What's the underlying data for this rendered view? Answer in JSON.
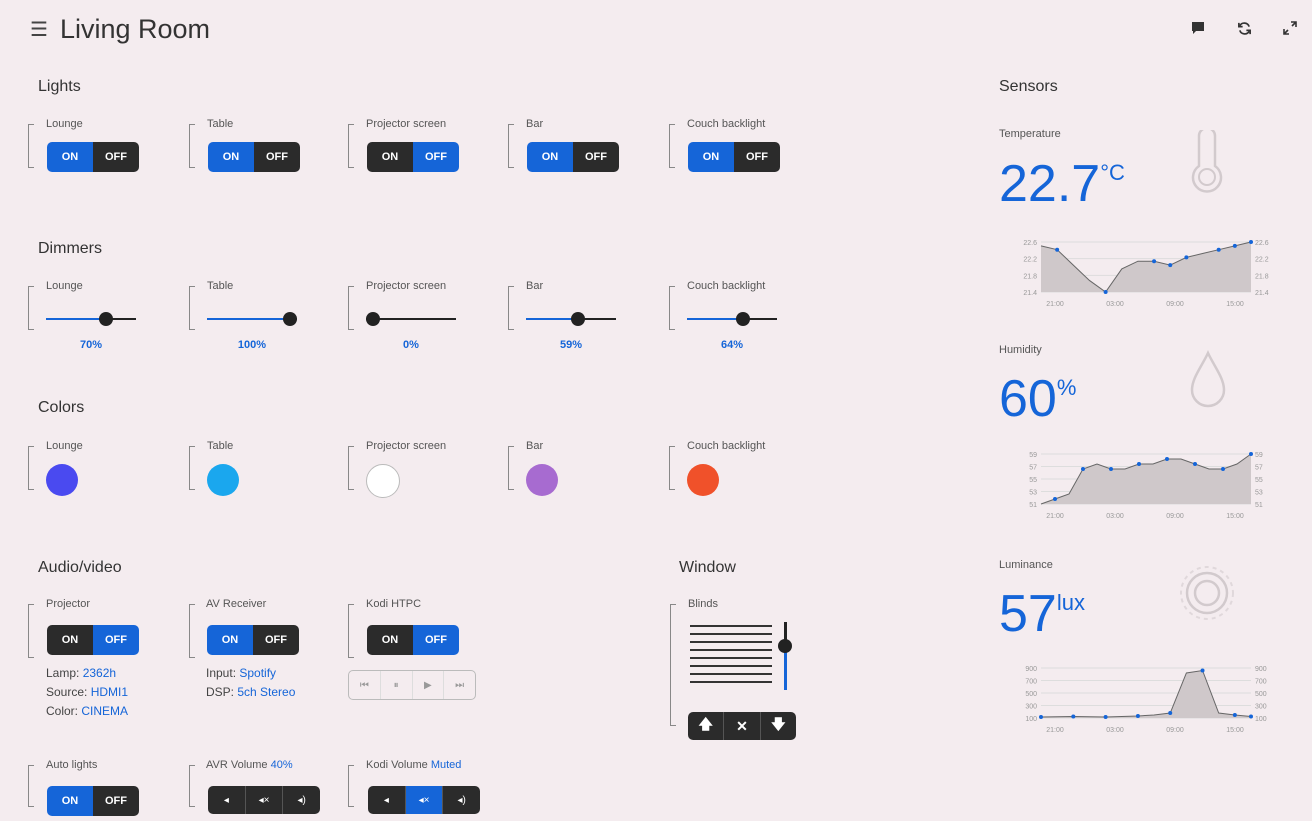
{
  "header": {
    "menu_icon": "hamburger-icon",
    "title": "Living Room",
    "icons": [
      "chat-icon",
      "refresh-icon",
      "expand-icon"
    ]
  },
  "lights": {
    "title": "Lights",
    "items": [
      {
        "label": "Lounge",
        "on": "ON",
        "off": "OFF",
        "state": "on"
      },
      {
        "label": "Table",
        "on": "ON",
        "off": "OFF",
        "state": "on"
      },
      {
        "label": "Projector screen",
        "on": "ON",
        "off": "OFF",
        "state": "off"
      },
      {
        "label": "Bar",
        "on": "ON",
        "off": "OFF",
        "state": "on"
      },
      {
        "label": "Couch backlight",
        "on": "ON",
        "off": "OFF",
        "state": "on"
      }
    ]
  },
  "dimmers": {
    "title": "Dimmers",
    "items": [
      {
        "label": "Lounge",
        "value": "70%",
        "level": 0.7
      },
      {
        "label": "Table",
        "value": "100%",
        "level": 1.0
      },
      {
        "label": "Projector screen",
        "value": "0%",
        "level": 0.0
      },
      {
        "label": "Bar",
        "value": "59%",
        "level": 0.59
      },
      {
        "label": "Couch backlight",
        "value": "64%",
        "level": 0.64
      }
    ]
  },
  "colors": {
    "title": "Colors",
    "items": [
      {
        "label": "Lounge",
        "color": "#4a4af0"
      },
      {
        "label": "Table",
        "color": "#1aa7ee"
      },
      {
        "label": "Projector screen",
        "color": "#ffffff"
      },
      {
        "label": "Bar",
        "color": "#a76bd0"
      },
      {
        "label": "Couch backlight",
        "color": "#f0512a"
      }
    ]
  },
  "av": {
    "title": "Audio/video",
    "projector": {
      "label": "Projector",
      "on": "ON",
      "off": "OFF",
      "state": "off",
      "lamp_label": "Lamp:",
      "lamp": "2362h",
      "source_label": "Source:",
      "source": "HDMI1",
      "color_label": "Color:",
      "color": "CINEMA"
    },
    "receiver": {
      "label": "AV Receiver",
      "on": "ON",
      "off": "OFF",
      "state": "on",
      "input_label": "Input:",
      "input": "Spotify",
      "dsp_label": "DSP:",
      "dsp": "5ch Stereo"
    },
    "kodi": {
      "label": "Kodi HTPC",
      "on": "ON",
      "off": "OFF",
      "state": "off",
      "controls": [
        "⏮",
        "⏸",
        "▶",
        "⏭"
      ]
    },
    "auto_lights": {
      "label": "Auto lights",
      "on": "ON",
      "off": "OFF",
      "state": "on"
    },
    "avr_volume": {
      "label": "AVR Volume",
      "value": "40%",
      "active": -1
    },
    "kodi_volume": {
      "label": "Kodi Volume",
      "value": "Muted",
      "active": 1
    }
  },
  "window": {
    "title": "Window",
    "blinds_label": "Blinds",
    "position": 0.35,
    "controls": [
      "🡅",
      "✕",
      "🡇"
    ]
  },
  "sensors": {
    "title": "Sensors",
    "temperature": {
      "label": "Temperature",
      "value": "22.7",
      "unit": "°C",
      "icon": "thermometer-icon"
    },
    "humidity": {
      "label": "Humidity",
      "value": "60",
      "unit": "%",
      "icon": "drop-icon"
    },
    "luminance": {
      "label": "Luminance",
      "value": "57",
      "unit": "lux",
      "icon": "sun-icon"
    }
  },
  "chart_data": [
    {
      "type": "area",
      "title": "",
      "x": [
        "21:00",
        "03:00",
        "09:00",
        "15:00"
      ],
      "yticks": [
        "22.6",
        "22.2",
        "21.8",
        "21.4"
      ],
      "ylim": [
        21.4,
        22.7
      ],
      "values": [
        22.6,
        22.5,
        22.1,
        21.7,
        21.4,
        22.0,
        22.2,
        22.2,
        22.1,
        22.3,
        22.4,
        22.5,
        22.6,
        22.7
      ],
      "markers": [
        1,
        4,
        7,
        8,
        9,
        11,
        12,
        13
      ]
    },
    {
      "type": "area",
      "title": "",
      "x": [
        "21:00",
        "03:00",
        "09:00",
        "15:00"
      ],
      "yticks": [
        "59",
        "57",
        "55",
        "53",
        "51"
      ],
      "ylim": [
        50,
        60
      ],
      "values": [
        50,
        51,
        52,
        57,
        58,
        57,
        57,
        58,
        58,
        59,
        59,
        58,
        57,
        57,
        58,
        60
      ],
      "markers": [
        1,
        3,
        5,
        7,
        9,
        11,
        13,
        15
      ]
    },
    {
      "type": "area",
      "title": "",
      "x": [
        "21:00",
        "03:00",
        "09:00",
        "15:00"
      ],
      "yticks": [
        "900",
        "700",
        "500",
        "300",
        "100"
      ],
      "ylim": [
        0,
        1000
      ],
      "values": [
        20,
        25,
        30,
        25,
        20,
        30,
        40,
        60,
        100,
        900,
        950,
        100,
        60,
        30
      ],
      "markers": [
        0,
        2,
        4,
        6,
        8,
        10,
        12,
        13
      ]
    }
  ]
}
